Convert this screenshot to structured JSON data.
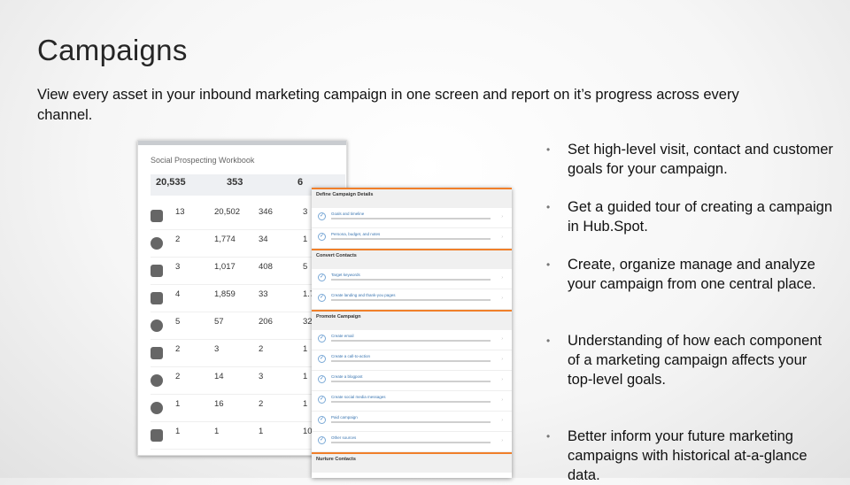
{
  "slide": {
    "title": "Campaigns",
    "subtitle": "View every asset in your inbound marketing campaign in one screen and report on it’s progress across every channel."
  },
  "bullets": [
    "Set high-level visit, contact and customer goals for your campaign.",
    "Get a guided tour of creating a campaign in Hub.Spot.",
    "Create, organize manage and analyze your campaign from one central place.",
    "Understanding of how each component of a marketing campaign affects your top-level goals.",
    "Better inform your future marketing campaigns with historical at-a-glance data."
  ],
  "workbook": {
    "title": "Social Prospecting Workbook",
    "stats": [
      "20,535",
      "353",
      "6"
    ],
    "rows": [
      {
        "icon": "page-icon",
        "cells": [
          "13",
          "20,502",
          "346",
          "3"
        ]
      },
      {
        "icon": "star-icon",
        "cells": [
          "2",
          "1,774",
          "34",
          "1"
        ]
      },
      {
        "icon": "mail-icon",
        "cells": [
          "3",
          "1,017",
          "408",
          "5"
        ]
      },
      {
        "icon": "blog-icon",
        "cells": [
          "4",
          "1,859",
          "33",
          "1.7"
        ]
      },
      {
        "icon": "chat-icon",
        "cells": [
          "5",
          "57",
          "206",
          "32"
        ]
      },
      {
        "icon": "key-icon",
        "cells": [
          "2",
          "3",
          "2",
          "1"
        ]
      },
      {
        "icon": "dollar-icon",
        "cells": [
          "2",
          "14",
          "3",
          "1"
        ]
      },
      {
        "icon": "globe-icon",
        "cells": [
          "1",
          "16",
          "2",
          "1"
        ]
      },
      {
        "icon": "shuffle-icon",
        "cells": [
          "1",
          "1",
          "1",
          "10"
        ]
      }
    ]
  },
  "details": {
    "sections": [
      {
        "title": "Define Campaign Details",
        "tasks": [
          "Goals and timeline",
          "Persona, budget, and notes"
        ]
      },
      {
        "title": "Convert Contacts",
        "tasks": [
          "Target keywords",
          "Create landing and thank-you pages"
        ]
      },
      {
        "title": "Promote Campaign",
        "tasks": [
          "Create email",
          "Create a call-to-action",
          "Create a blogpost",
          "Create social media messages",
          "Paid campaign",
          "Other sources"
        ]
      },
      {
        "title": "Nurture Contacts",
        "tasks": []
      }
    ]
  }
}
